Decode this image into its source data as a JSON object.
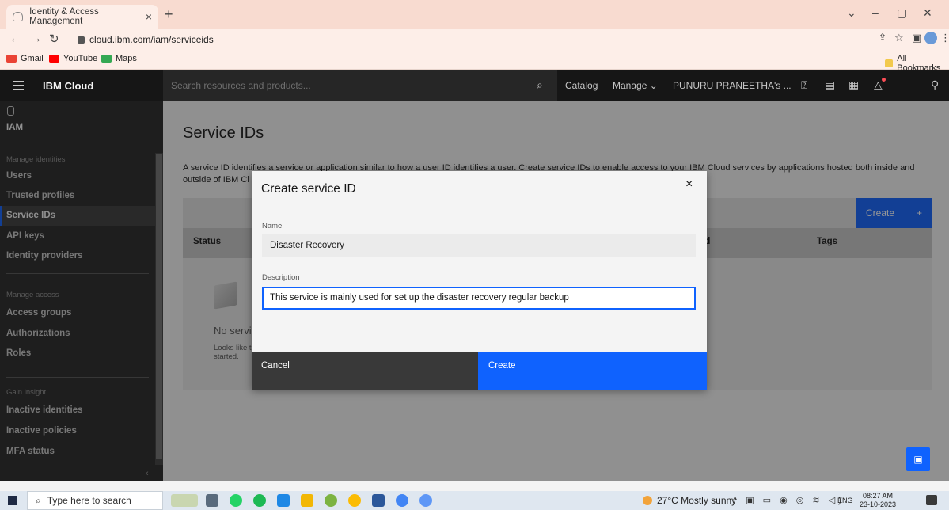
{
  "browser": {
    "tab_title": "Identity & Access Management",
    "url": "cloud.ibm.com/iam/serviceids",
    "bookmarks": [
      "Gmail",
      "YouTube",
      "Maps"
    ],
    "all_bookmarks": "All Bookmarks"
  },
  "header": {
    "brand": "IBM Cloud",
    "search_placeholder": "Search resources and products...",
    "catalog": "Catalog",
    "manage": "Manage",
    "account": "PUNURU PRANEETHA's ..."
  },
  "sidebar": {
    "title": "IAM",
    "sections": [
      {
        "label": "Manage identities",
        "items": [
          "Users",
          "Trusted profiles",
          "Service IDs",
          "API keys",
          "Identity providers"
        ]
      },
      {
        "label": "Manage access",
        "items": [
          "Access groups",
          "Authorizations",
          "Roles"
        ]
      },
      {
        "label": "Gain insight",
        "items": [
          "Inactive identities",
          "Inactive policies",
          "MFA status"
        ]
      }
    ],
    "active_item": "Service IDs"
  },
  "page": {
    "title": "Service IDs",
    "description": "A service ID identifies a service or application similar to how a user ID identifies a user. Create service IDs to enable access to your IBM Cloud services by applications hosted both inside and outside of IBM Cl",
    "create_button": "Create",
    "create_plus": "+",
    "columns": [
      "Status",
      "ed",
      "Tags"
    ],
    "empty_title": "No servic",
    "empty_subtitle": "Looks like t started."
  },
  "modal": {
    "title": "Create service ID",
    "close": "×",
    "name_label": "Name",
    "name_value": "Disaster Recovery",
    "description_label": "Description",
    "description_value": "This service is mainly used for set up the disaster recovery regular backup",
    "cancel": "Cancel",
    "create": "Create"
  },
  "taskbar": {
    "search_placeholder": "Type here to search",
    "weather": "27°C  Mostly sunny",
    "lang": "ENG",
    "time": "08:27 AM",
    "date": "23-10-2023"
  },
  "colors": {
    "primary": "#0f62fe",
    "header": "#161616",
    "sidebar": "#262626"
  }
}
